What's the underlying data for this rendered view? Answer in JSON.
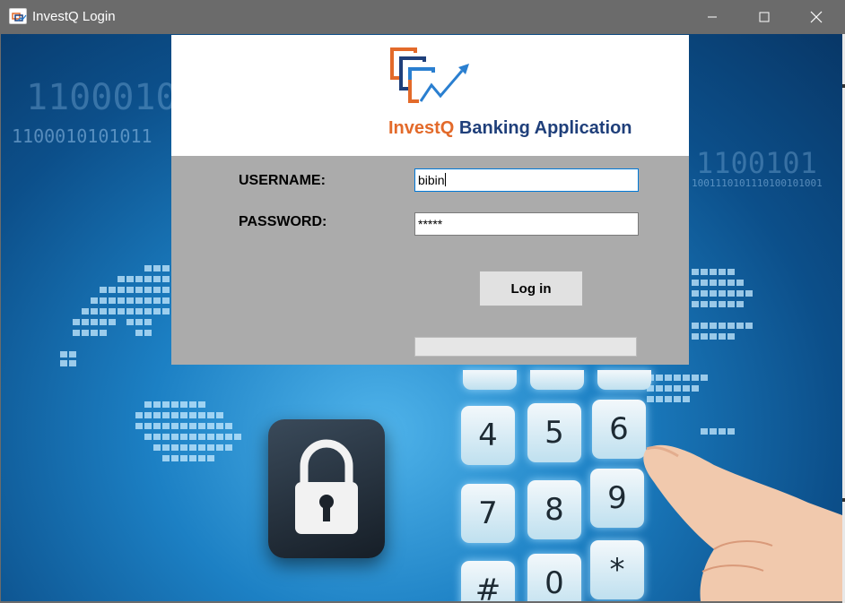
{
  "window": {
    "title": "InvestQ Login",
    "icon": "investq-app-icon",
    "controls": [
      "minimize-icon",
      "maximize-icon",
      "close-icon"
    ]
  },
  "logo": {
    "brand": "InvestQ",
    "suffix": " Banking Application",
    "brand_color": "#e36a2a",
    "suffix_color": "#1f3f7a"
  },
  "form": {
    "username_label": "USERNAME:",
    "username_value": "bibin",
    "password_label": "PASSWORD:",
    "password_value": "*****",
    "login_label": "Log in",
    "progress": 0
  },
  "background": {
    "binary_lines": [
      "1100010",
      "1100010101011",
      "1100101",
      "1001110101110100101001"
    ],
    "keypad": [
      "4",
      "5",
      "6",
      "7",
      "8",
      "9",
      "#",
      "0",
      "*"
    ]
  },
  "colors": {
    "title_bar": "#6b6b6b",
    "form_panel": "#ababab",
    "focus_border": "#0078d7"
  }
}
